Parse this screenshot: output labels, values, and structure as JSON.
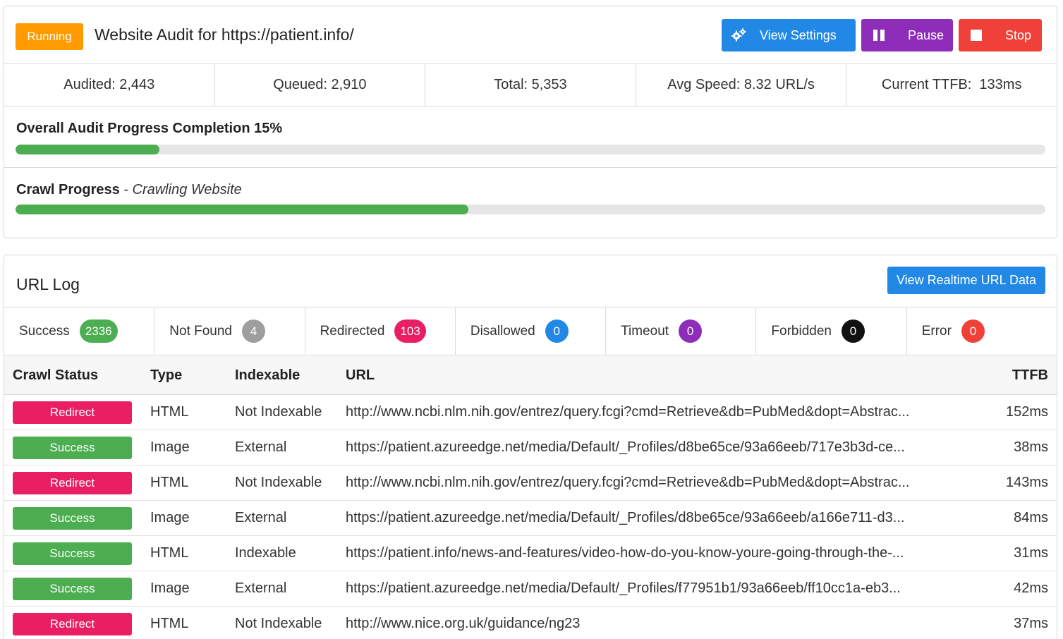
{
  "header": {
    "status_badge": "Running",
    "title": "Website Audit for https://patient.info/",
    "buttons": {
      "view_settings": "View Settings",
      "pause": "Pause",
      "stop": "Stop"
    }
  },
  "stats": {
    "audited": "Audited: 2,443",
    "queued": "Queued: 2,910",
    "total": "Total: 5,353",
    "avg_speed": "Avg Speed: 8.32 URL/s",
    "current_ttfb": "Current TTFB:  133ms"
  },
  "progress": {
    "overall_label": "Overall Audit Progress Completion 15%",
    "overall_percent": 14,
    "crawl_label": "Crawl Progress",
    "crawl_sub": " - Crawling Website",
    "crawl_percent": 44
  },
  "url_log": {
    "title": "URL Log",
    "realtime_button": "View Realtime URL Data",
    "counts": [
      {
        "label": "Success",
        "value": "2336",
        "color": "#4cae50"
      },
      {
        "label": "Not Found",
        "value": "4",
        "color": "#9e9e9e"
      },
      {
        "label": "Redirected",
        "value": "103",
        "color": "#e91e63"
      },
      {
        "label": "Disallowed",
        "value": "0",
        "color": "#2188e6"
      },
      {
        "label": "Timeout",
        "value": "0",
        "color": "#8e2dba"
      },
      {
        "label": "Forbidden",
        "value": "0",
        "color": "#111111"
      },
      {
        "label": "Error",
        "value": "0",
        "color": "#f0403a"
      }
    ],
    "columns": {
      "crawl_status": "Crawl Status",
      "type": "Type",
      "indexable": "Indexable",
      "url": "URL",
      "ttfb": "TTFB"
    },
    "rows": [
      {
        "status": "Redirect",
        "type": "HTML",
        "indexable": "Not Indexable",
        "url": "http://www.ncbi.nlm.nih.gov/entrez/query.fcgi?cmd=Retrieve&db=PubMed&dopt=Abstrac...",
        "ttfb": "152ms"
      },
      {
        "status": "Success",
        "type": "Image",
        "indexable": "External",
        "url": "https://patient.azureedge.net/media/Default/_Profiles/d8be65ce/93a66eeb/717e3b3d-ce...",
        "ttfb": "38ms"
      },
      {
        "status": "Redirect",
        "type": "HTML",
        "indexable": "Not Indexable",
        "url": "http://www.ncbi.nlm.nih.gov/entrez/query.fcgi?cmd=Retrieve&db=PubMed&dopt=Abstrac...",
        "ttfb": "143ms"
      },
      {
        "status": "Success",
        "type": "Image",
        "indexable": "External",
        "url": "https://patient.azureedge.net/media/Default/_Profiles/d8be65ce/93a66eeb/a166e711-d3...",
        "ttfb": "84ms"
      },
      {
        "status": "Success",
        "type": "HTML",
        "indexable": "Indexable",
        "url": "https://patient.info/news-and-features/video-how-do-you-know-youre-going-through-the-...",
        "ttfb": "31ms"
      },
      {
        "status": "Success",
        "type": "Image",
        "indexable": "External",
        "url": "https://patient.azureedge.net/media/Default/_Profiles/f77951b1/93a66eeb/ff10cc1a-eb3...",
        "ttfb": "42ms"
      },
      {
        "status": "Redirect",
        "type": "HTML",
        "indexable": "Not Indexable",
        "url": "http://www.nice.org.uk/guidance/ng23",
        "ttfb": "37ms"
      }
    ]
  },
  "colors": {
    "running": "#ff9a00",
    "success": "#4cae50",
    "redirect": "#e91e63",
    "primary": "#2188e6",
    "purple": "#8e2dba",
    "danger": "#f0403a"
  }
}
